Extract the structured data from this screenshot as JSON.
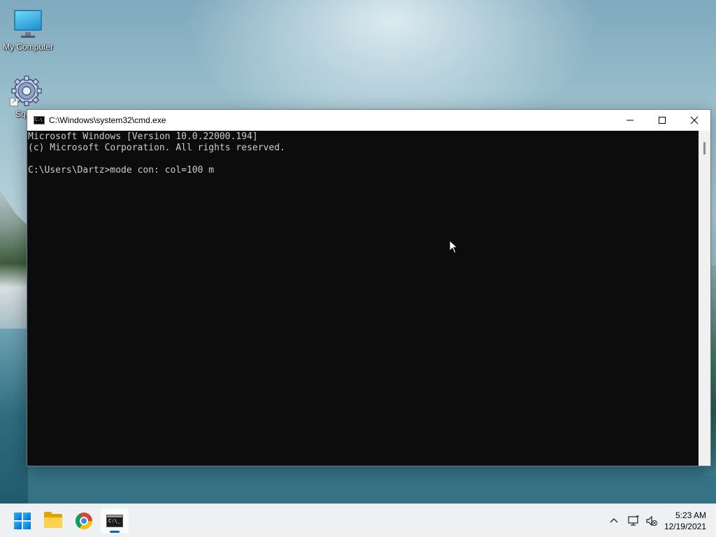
{
  "desktop": {
    "icons": [
      {
        "label": "My Computer",
        "icon": "monitor-icon"
      },
      {
        "label": "Squ",
        "icon": "gear-icon"
      }
    ]
  },
  "window": {
    "title": "C:\\Windows\\system32\\cmd.exe",
    "controls": {
      "minimize": "minimize-icon",
      "maximize": "maximize-icon",
      "close": "close-icon"
    },
    "console_lines": [
      "Microsoft Windows [Version 10.0.22000.194]",
      "(c) Microsoft Corporation. All rights reserved.",
      "",
      "C:\\Users\\Dartz>mode con: col=100 m"
    ]
  },
  "taskbar": {
    "items": [
      {
        "name": "start",
        "icon": "windows-logo-icon"
      },
      {
        "name": "file-explorer",
        "icon": "folder-icon"
      },
      {
        "name": "chrome",
        "icon": "chrome-icon"
      },
      {
        "name": "command-prompt",
        "icon": "terminal-icon",
        "active": true
      }
    ],
    "tray": {
      "icons": [
        "chevron-up-icon",
        "network-icon",
        "volume-muted-icon"
      ]
    },
    "clock": {
      "time": "5:23 AM",
      "date": "12/19/2021"
    }
  },
  "colors": {
    "console_bg": "#0c0c0c",
    "console_fg": "#cccccc",
    "accent": "#0067c0"
  }
}
